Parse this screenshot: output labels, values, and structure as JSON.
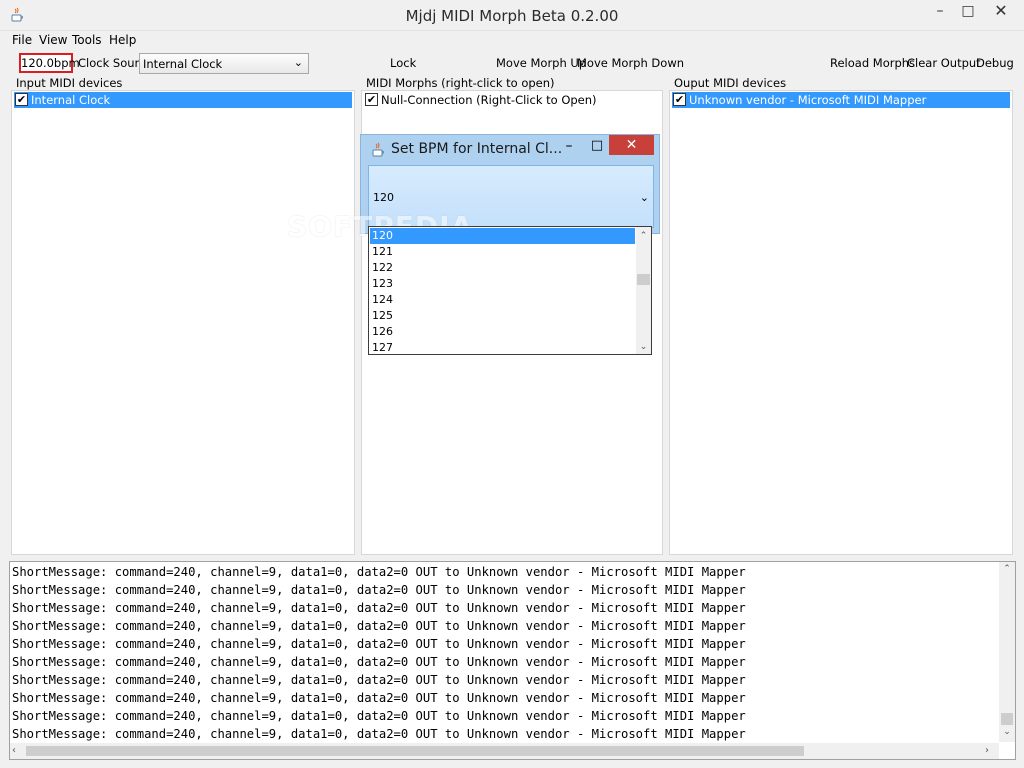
{
  "window": {
    "title": "Mjdj MIDI Morph Beta 0.2.00",
    "min_icon": "–",
    "max_icon": "□",
    "close_icon": "✕"
  },
  "menu": [
    "File",
    "View",
    "Tools",
    "Help"
  ],
  "toolbar": {
    "bpm": "120.0bpm",
    "clock_source_label": "Clock Source",
    "clock_source_value": "Internal Clock",
    "lock": "Lock",
    "move_up": "Move Morph Up",
    "move_down": "Move Morph Down",
    "reload": "Reload Morphs",
    "clear_output": "Clear Output",
    "debug": "Debug"
  },
  "panels": {
    "input": {
      "label": "Input MIDI devices",
      "items": [
        {
          "label": "Internal Clock",
          "checked": true,
          "selected": true
        }
      ]
    },
    "morphs": {
      "label": "MIDI Morphs (right-click to open)",
      "items": [
        {
          "label": "Null-Connection (Right-Click to Open)",
          "checked": true,
          "selected": false
        }
      ]
    },
    "output": {
      "label": "Ouput MIDI devices",
      "items": [
        {
          "label": "Unknown vendor - Microsoft MIDI Mapper",
          "checked": true,
          "selected": true
        }
      ]
    }
  },
  "dialog": {
    "title": "Set BPM for Internal Cl...",
    "value": "120",
    "options": [
      "120",
      "121",
      "122",
      "123",
      "124",
      "125",
      "126",
      "127"
    ],
    "selected_index": 0
  },
  "watermark": "SOFTPEDIA",
  "output_lines": [
    "ShortMessage: command=240, channel=9, data1=0, data2=0 OUT to Unknown vendor - Microsoft MIDI Mapper",
    "ShortMessage: command=240, channel=9, data1=0, data2=0 OUT to Unknown vendor - Microsoft MIDI Mapper",
    "ShortMessage: command=240, channel=9, data1=0, data2=0 OUT to Unknown vendor - Microsoft MIDI Mapper",
    "ShortMessage: command=240, channel=9, data1=0, data2=0 OUT to Unknown vendor - Microsoft MIDI Mapper",
    "ShortMessage: command=240, channel=9, data1=0, data2=0 OUT to Unknown vendor - Microsoft MIDI Mapper",
    "ShortMessage: command=240, channel=9, data1=0, data2=0 OUT to Unknown vendor - Microsoft MIDI Mapper",
    "ShortMessage: command=240, channel=9, data1=0, data2=0 OUT to Unknown vendor - Microsoft MIDI Mapper",
    "ShortMessage: command=240, channel=9, data1=0, data2=0 OUT to Unknown vendor - Microsoft MIDI Mapper",
    "ShortMessage: command=240, channel=9, data1=0, data2=0 OUT to Unknown vendor - Microsoft MIDI Mapper",
    "ShortMessage: command=240, channel=9, data1=0, data2=0 OUT to Unknown vendor - Microsoft MIDI Mapper"
  ],
  "colors": {
    "selection": "#3399ff",
    "bpm_border": "#d81e1e",
    "dialog_close": "#c7413a",
    "dialog_frame": "#aed1f0"
  }
}
